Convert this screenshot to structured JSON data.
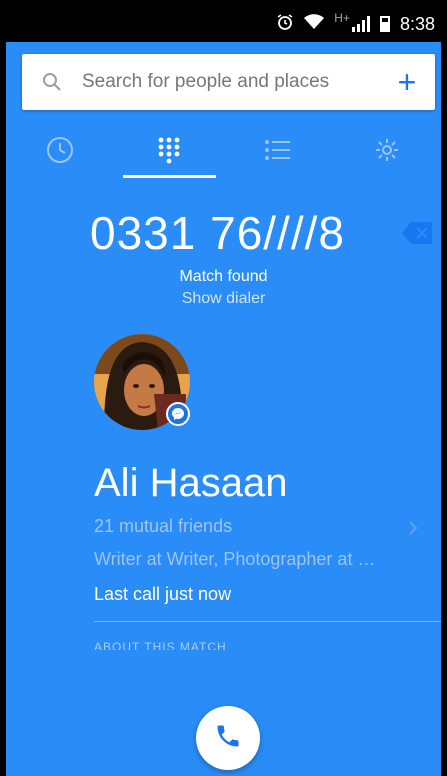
{
  "status_bar": {
    "time": "8:38",
    "network": "H+"
  },
  "search": {
    "placeholder": "Search for people and places"
  },
  "tabs": [
    {
      "name": "recent",
      "icon": "clock-icon",
      "active": false
    },
    {
      "name": "dialpad",
      "icon": "dialpad-icon",
      "active": true
    },
    {
      "name": "contacts",
      "icon": "list-icon",
      "active": false
    },
    {
      "name": "settings",
      "icon": "gear-icon",
      "active": false
    }
  ],
  "dialer": {
    "number": "0331 76////8",
    "match_found": "Match found",
    "show_dialer": "Show dialer"
  },
  "contact": {
    "name": "Ali Hasaan",
    "mutual": "21 mutual friends",
    "work": "Writer at Writer, Photographer at …",
    "last_call": "Last call just now",
    "about_header": "ABOUT THIS MATCH"
  },
  "colors": {
    "background": "#2a8cf6",
    "accent": "#1976f2"
  }
}
